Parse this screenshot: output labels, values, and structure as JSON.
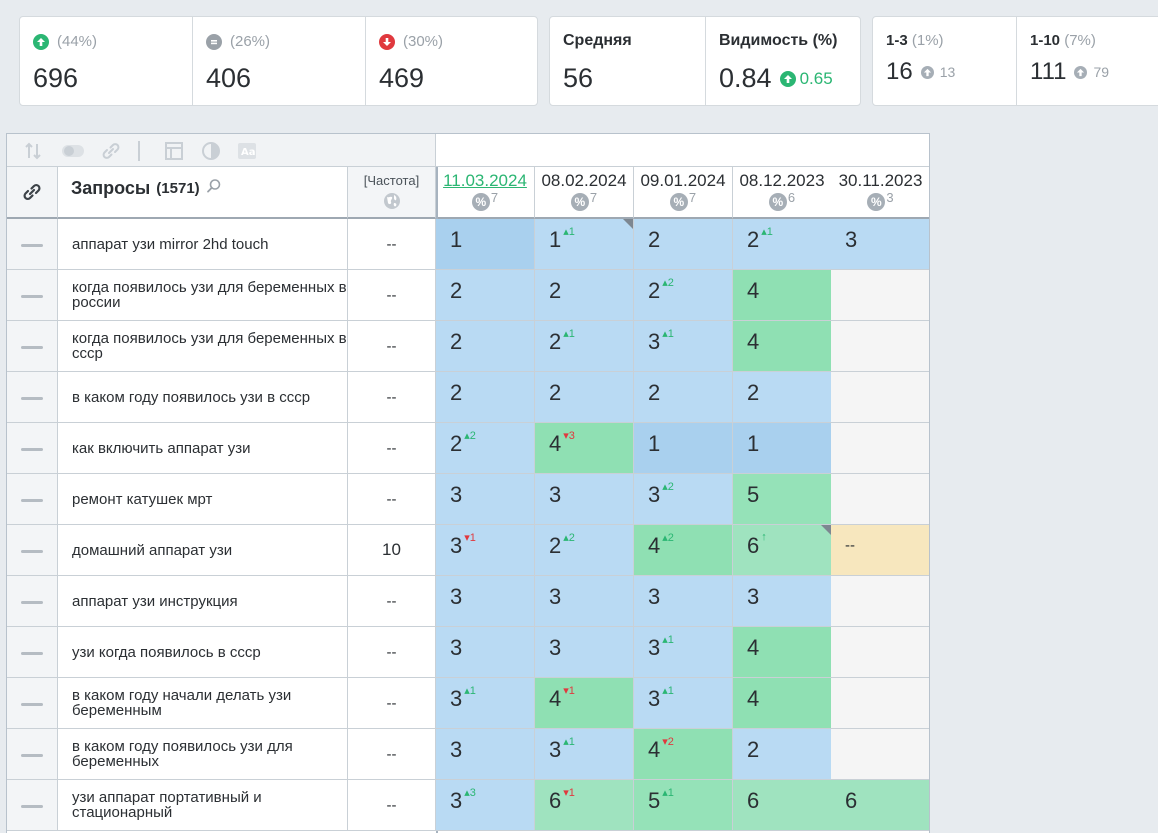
{
  "summary": {
    "up": {
      "pct": "(44%)",
      "value": "696"
    },
    "same": {
      "pct": "(26%)",
      "value": "406"
    },
    "down": {
      "pct": "(30%)",
      "value": "469"
    },
    "avg": {
      "label": "Средняя",
      "value": "56"
    },
    "visibility": {
      "label": "Видимость (%)",
      "value": "0.84",
      "delta": "0.65"
    },
    "top3": {
      "label": "1-3",
      "pct": "(1%)",
      "value": "16",
      "delta": "13"
    },
    "top10": {
      "label": "1-10",
      "pct": "(7%)",
      "value": "111",
      "delta": "79"
    }
  },
  "table": {
    "query_header": "Запросы",
    "query_count": "(1571)",
    "freq_header": "[Частота]",
    "dates": [
      {
        "label": "11.03.2024",
        "count": "7",
        "active": true
      },
      {
        "label": "08.02.2024",
        "count": "7",
        "active": false
      },
      {
        "label": "09.01.2024",
        "count": "7",
        "active": false
      },
      {
        "label": "08.12.2023",
        "count": "6",
        "active": false
      },
      {
        "label": "30.11.2023",
        "count": "3",
        "active": false
      }
    ],
    "rows": [
      {
        "query": "аппарат узи mirror 2hd touch",
        "freq": "--",
        "cells": [
          {
            "v": "1",
            "bg": "#a9d0ee"
          },
          {
            "v": "1",
            "ch": "1",
            "dir": "up",
            "bg": "#b9daf3",
            "corner": true
          },
          {
            "v": "2",
            "bg": "#b9daf3"
          },
          {
            "v": "2",
            "ch": "1",
            "dir": "up",
            "bg": "#b9daf3"
          },
          {
            "v": "3",
            "bg": "#b9daf3"
          }
        ]
      },
      {
        "query": "когда появилось узи для беременных в россии",
        "freq": "--",
        "cells": [
          {
            "v": "2",
            "bg": "#b9daf3"
          },
          {
            "v": "2",
            "bg": "#b9daf3"
          },
          {
            "v": "2",
            "ch": "2",
            "dir": "up",
            "bg": "#b9daf3"
          },
          {
            "v": "4",
            "bg": "#8fe0b3"
          },
          {
            "v": "",
            "bg": "#f5f5f5"
          }
        ]
      },
      {
        "query": "когда появилось узи для беременных в ссср",
        "freq": "--",
        "cells": [
          {
            "v": "2",
            "bg": "#b9daf3"
          },
          {
            "v": "2",
            "ch": "1",
            "dir": "up",
            "bg": "#b9daf3"
          },
          {
            "v": "3",
            "ch": "1",
            "dir": "up",
            "bg": "#b9daf3"
          },
          {
            "v": "4",
            "bg": "#8fe0b3"
          },
          {
            "v": "",
            "bg": "#f5f5f5"
          }
        ]
      },
      {
        "query": "в каком году появилось узи в ссср",
        "freq": "--",
        "cells": [
          {
            "v": "2",
            "bg": "#b9daf3"
          },
          {
            "v": "2",
            "bg": "#b9daf3"
          },
          {
            "v": "2",
            "bg": "#b9daf3"
          },
          {
            "v": "2",
            "bg": "#b9daf3"
          },
          {
            "v": "",
            "bg": "#f5f5f5"
          }
        ]
      },
      {
        "query": "как включить аппарат узи",
        "freq": "--",
        "cells": [
          {
            "v": "2",
            "ch": "2",
            "dir": "up",
            "bg": "#b9daf3"
          },
          {
            "v": "4",
            "ch": "3",
            "dir": "down",
            "bg": "#8fe0b3"
          },
          {
            "v": "1",
            "bg": "#a9d0ee"
          },
          {
            "v": "1",
            "bg": "#a9d0ee"
          },
          {
            "v": "",
            "bg": "#f5f5f5"
          }
        ]
      },
      {
        "query": "ремонт катушек мрт",
        "freq": "--",
        "cells": [
          {
            "v": "3",
            "bg": "#b9daf3"
          },
          {
            "v": "3",
            "bg": "#b9daf3"
          },
          {
            "v": "3",
            "ch": "2",
            "dir": "up",
            "bg": "#b9daf3"
          },
          {
            "v": "5",
            "bg": "#95e2b8"
          },
          {
            "v": "",
            "bg": "#f5f5f5"
          }
        ]
      },
      {
        "query": "домашний аппарат узи",
        "freq": "10",
        "cells": [
          {
            "v": "3",
            "ch": "1",
            "dir": "down",
            "bg": "#b9daf3"
          },
          {
            "v": "2",
            "ch": "2",
            "dir": "up",
            "bg": "#b9daf3"
          },
          {
            "v": "4",
            "ch": "2",
            "dir": "up",
            "bg": "#8fe0b3"
          },
          {
            "v": "6",
            "ch": "↑",
            "dir": "up",
            "bg": "#9fe3bf",
            "corner": true
          },
          {
            "v": "--",
            "bg": "#f7e7be",
            "dash": true
          }
        ]
      },
      {
        "query": "аппарат узи инструкция",
        "freq": "--",
        "cells": [
          {
            "v": "3",
            "bg": "#b9daf3"
          },
          {
            "v": "3",
            "bg": "#b9daf3"
          },
          {
            "v": "3",
            "bg": "#b9daf3"
          },
          {
            "v": "3",
            "bg": "#b9daf3"
          },
          {
            "v": "",
            "bg": "#f5f5f5"
          }
        ]
      },
      {
        "query": "узи когда появилось в ссср",
        "freq": "--",
        "cells": [
          {
            "v": "3",
            "bg": "#b9daf3"
          },
          {
            "v": "3",
            "bg": "#b9daf3"
          },
          {
            "v": "3",
            "ch": "1",
            "dir": "up",
            "bg": "#b9daf3"
          },
          {
            "v": "4",
            "bg": "#8fe0b3"
          },
          {
            "v": "",
            "bg": "#f5f5f5"
          }
        ]
      },
      {
        "query": "в каком году начали делать узи беременным",
        "freq": "--",
        "cells": [
          {
            "v": "3",
            "ch": "1",
            "dir": "up",
            "bg": "#b9daf3"
          },
          {
            "v": "4",
            "ch": "1",
            "dir": "down",
            "bg": "#8fe0b3"
          },
          {
            "v": "3",
            "ch": "1",
            "dir": "up",
            "bg": "#b9daf3"
          },
          {
            "v": "4",
            "bg": "#8fe0b3"
          },
          {
            "v": "",
            "bg": "#f5f5f5"
          }
        ]
      },
      {
        "query": "в каком году появилось узи для беременных",
        "freq": "--",
        "cells": [
          {
            "v": "3",
            "bg": "#b9daf3"
          },
          {
            "v": "3",
            "ch": "1",
            "dir": "up",
            "bg": "#b9daf3"
          },
          {
            "v": "4",
            "ch": "2",
            "dir": "down",
            "bg": "#8fe0b3"
          },
          {
            "v": "2",
            "bg": "#b9daf3"
          },
          {
            "v": "",
            "bg": "#f5f5f5"
          }
        ]
      },
      {
        "query": "узи аппарат портативный и стационарный",
        "freq": "--",
        "cells": [
          {
            "v": "3",
            "ch": "3",
            "dir": "up",
            "bg": "#b9daf3"
          },
          {
            "v": "6",
            "ch": "1",
            "dir": "down",
            "bg": "#9fe3bf"
          },
          {
            "v": "5",
            "ch": "1",
            "dir": "up",
            "bg": "#95e2b8"
          },
          {
            "v": "6",
            "bg": "#9fe3bf"
          },
          {
            "v": "6",
            "bg": "#9fe3bf"
          }
        ]
      }
    ]
  }
}
